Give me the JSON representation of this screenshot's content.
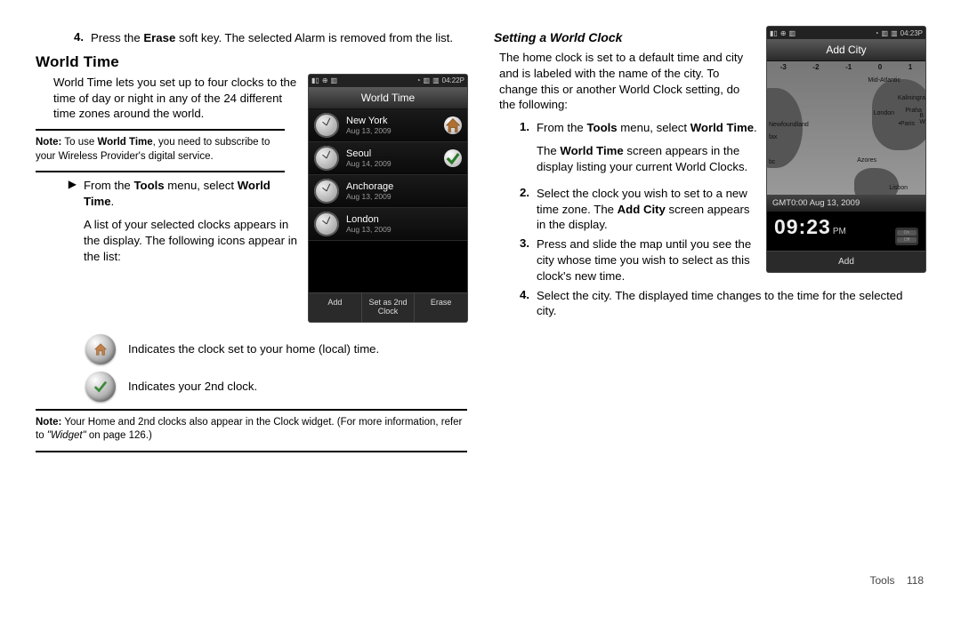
{
  "left": {
    "step4": {
      "num": "4.",
      "text_a": "Press the ",
      "bold": "Erase",
      "text_b": " soft key. The selected Alarm is removed from the list."
    },
    "heading": "World Time",
    "intro": "World Time lets you set up to four clocks to the time of day or night in any of the 24 different time zones around the world.",
    "note1": {
      "label": "Note:",
      "a": " To use ",
      "b": "World Time",
      "c": ", you need to subscribe to your Wireless Provider's digital service."
    },
    "bullet1": {
      "a": "From the ",
      "b": "Tools",
      "c": " menu, select ",
      "d": "World Time",
      "e": "."
    },
    "bullet1b": "A list of your selected clocks appears in the display. The following icons appear in the list:",
    "legend_home": "Indicates the clock set to your home (local) time.",
    "legend_check": "Indicates your 2nd clock.",
    "note2": {
      "label": "Note:",
      "a": " Your Home and 2nd clocks also appear in the Clock widget. (For more information, refer to ",
      "i": "\"Widget\"",
      "b": "  on page 126.)"
    }
  },
  "phone1": {
    "status_time": "04:22P",
    "title": "World Time",
    "rows": [
      {
        "city": "New York",
        "date": "Aug 13, 2009",
        "badge": "home"
      },
      {
        "city": "Seoul",
        "date": "Aug 14, 2009",
        "badge": "check"
      },
      {
        "city": "Anchorage",
        "date": "Aug 13, 2009",
        "badge": ""
      },
      {
        "city": "London",
        "date": "Aug 13, 2009",
        "badge": ""
      }
    ],
    "sk": [
      "Add",
      "Set as 2nd\nClock",
      "Erase"
    ]
  },
  "right": {
    "subheading": "Setting a World Clock",
    "intro": "The home clock is set to a default time and city and is labeled with the name of the city. To change this or another World Clock setting, do the following:",
    "s1": {
      "num": "1.",
      "a": "From the ",
      "b": "Tools",
      "c": " menu, select ",
      "d": "World Time",
      "e": "."
    },
    "s1b": {
      "a": "The ",
      "b": "World Time",
      "c": " screen appears in the display listing your current World Clocks."
    },
    "s2": {
      "num": "2.",
      "a": "Select the clock you wish to set to a new time zone. The ",
      "b": "Add City",
      "c": " screen appears in the display."
    },
    "s3": {
      "num": "3.",
      "t": "Press and slide the map until you see the city whose time you wish to select as this clock's new time."
    },
    "s4": {
      "num": "4.",
      "t": "Select the city. The displayed time changes to the time for the selected city."
    }
  },
  "phone2": {
    "status_time": "04:23P",
    "title": "Add City",
    "ticks": [
      "-3",
      "-2",
      "-1",
      "0",
      "1"
    ],
    "labels": {
      "midatl": "Mid-Atlantic",
      "newf": "Newfoundland",
      "fax": "fax",
      "bc": "bc",
      "london": "London",
      "paris": "•Paris",
      "praha": "Praha",
      "kalin": "Kaliningra",
      "bw": "B\nW",
      "azores": "Azores",
      "lisbon": "Lisbon"
    },
    "info": "GMT0:00 Aug 13, 2009",
    "time": "09:23",
    "ampm": "PM",
    "tog_on": "On",
    "tog_off": "Off",
    "sk": "Add"
  },
  "footer": {
    "section": "Tools",
    "page": "118"
  }
}
